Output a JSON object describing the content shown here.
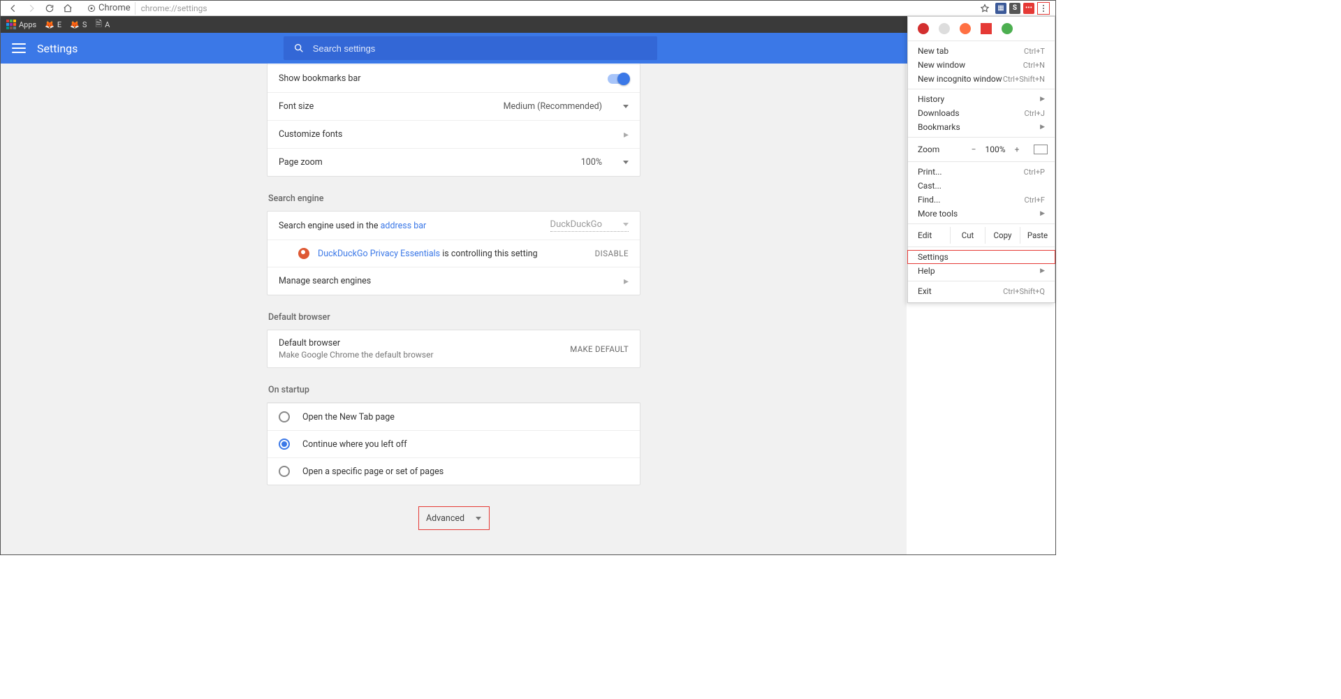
{
  "browser": {
    "origin_label": "Chrome",
    "url": "chrome://settings",
    "bookmarks": {
      "apps": "Apps",
      "items": [
        "E",
        "S",
        "A"
      ]
    }
  },
  "header": {
    "title": "Settings",
    "search_placeholder": "Search settings"
  },
  "appearance": {
    "bookmarks_bar": "Show bookmarks bar",
    "font_size_label": "Font size",
    "font_size_value": "Medium (Recommended)",
    "customize_fonts": "Customize fonts",
    "page_zoom_label": "Page zoom",
    "page_zoom_value": "100%"
  },
  "search_engine": {
    "section": "Search engine",
    "used_in_prefix": "Search engine used in the ",
    "address_bar": "address bar",
    "value": "DuckDuckGo",
    "ext_name": "DuckDuckGo Privacy Essentials",
    "ext_suffix": " is controlling this setting",
    "disable": "DISABLE",
    "manage": "Manage search engines"
  },
  "default_browser": {
    "section": "Default browser",
    "title": "Default browser",
    "sub": "Make Google Chrome the default browser",
    "btn": "MAKE DEFAULT"
  },
  "startup": {
    "section": "On startup",
    "opt1": "Open the New Tab page",
    "opt2": "Continue where you left off",
    "opt3": "Open a specific page or set of pages"
  },
  "advanced": "Advanced",
  "menu": {
    "new_tab": "New tab",
    "new_tab_sc": "Ctrl+T",
    "new_window": "New window",
    "new_window_sc": "Ctrl+N",
    "incognito": "New incognito window",
    "incognito_sc": "Ctrl+Shift+N",
    "history": "History",
    "downloads": "Downloads",
    "downloads_sc": "Ctrl+J",
    "bookmarks": "Bookmarks",
    "zoom": "Zoom",
    "zoom_val": "100%",
    "print": "Print...",
    "print_sc": "Ctrl+P",
    "cast": "Cast...",
    "find": "Find...",
    "find_sc": "Ctrl+F",
    "more_tools": "More tools",
    "edit": "Edit",
    "cut": "Cut",
    "copy": "Copy",
    "paste": "Paste",
    "settings": "Settings",
    "help": "Help",
    "exit": "Exit",
    "exit_sc": "Ctrl+Shift+Q"
  }
}
